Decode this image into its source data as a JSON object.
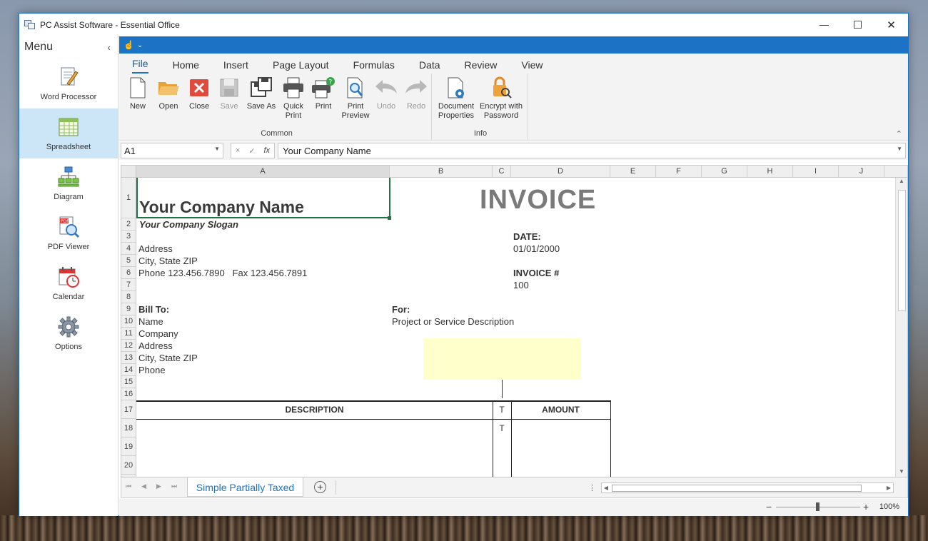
{
  "window": {
    "title": "PC Assist Software - Essential Office",
    "controls": {
      "minimize": "—",
      "maximize": "☐",
      "close": "✕"
    }
  },
  "sidebar": {
    "title": "Menu",
    "collapse_icon": "chevron-left-icon",
    "items": [
      {
        "label": "Word Processor",
        "icon": "word-processor-icon",
        "active": false
      },
      {
        "label": "Spreadsheet",
        "icon": "spreadsheet-icon",
        "active": true
      },
      {
        "label": "Diagram",
        "icon": "diagram-icon",
        "active": false
      },
      {
        "label": "PDF Viewer",
        "icon": "pdf-viewer-icon",
        "active": false
      },
      {
        "label": "Calendar",
        "icon": "calendar-icon",
        "active": false
      },
      {
        "label": "Options",
        "icon": "gear-icon",
        "active": false
      }
    ]
  },
  "qat": {
    "icon": "touch-mode-icon",
    "dropdown": "⌄"
  },
  "ribbon": {
    "tabs": [
      "File",
      "Home",
      "Insert",
      "Page Layout",
      "Formulas",
      "Data",
      "Review",
      "View"
    ],
    "active_tab": "File",
    "groups": {
      "common": {
        "label": "Common",
        "buttons": [
          {
            "label": "New",
            "icon": "new-document-icon",
            "enabled": true
          },
          {
            "label": "Open",
            "icon": "folder-open-icon",
            "enabled": true
          },
          {
            "label": "Close",
            "icon": "close-document-icon",
            "enabled": true
          },
          {
            "label": "Save",
            "icon": "save-icon",
            "enabled": false
          },
          {
            "label": "Save As",
            "icon": "save-as-icon",
            "enabled": true
          },
          {
            "label": "Quick\nPrint",
            "icon": "quick-print-icon",
            "enabled": true
          },
          {
            "label": "Print",
            "icon": "print-icon",
            "enabled": true
          },
          {
            "label": "Print\nPreview",
            "icon": "print-preview-icon",
            "enabled": true
          },
          {
            "label": "Undo",
            "icon": "undo-icon",
            "enabled": false
          },
          {
            "label": "Redo",
            "icon": "redo-icon",
            "enabled": false
          }
        ]
      },
      "info": {
        "label": "Info",
        "buttons": [
          {
            "label": "Document\nProperties",
            "icon": "document-properties-icon",
            "enabled": true
          },
          {
            "label": "Encrypt with\nPassword",
            "icon": "encrypt-lock-icon",
            "enabled": true
          }
        ]
      }
    }
  },
  "formula_bar": {
    "name_box": "A1",
    "cancel_symbol": "×",
    "enter_symbol": "✓",
    "fx_symbol": "fx",
    "value": "Your Company Name"
  },
  "sheet": {
    "columns": [
      "A",
      "B",
      "C",
      "D",
      "E",
      "F",
      "G",
      "H",
      "I",
      "J"
    ],
    "rows": [
      "1",
      "2",
      "3",
      "4",
      "5",
      "6",
      "7",
      "8",
      "9",
      "10",
      "11",
      "12",
      "13",
      "14",
      "15",
      "16",
      "17",
      "18",
      "19",
      "20"
    ],
    "cells": {
      "company_name": "Your Company Name",
      "invoice_title": "INVOICE",
      "slogan": "Your Company Slogan",
      "date_label": "DATE:",
      "address": "Address",
      "date_value": "01/01/2000",
      "city_state_zip": "City, State ZIP",
      "phone_fax": "Phone 123.456.7890   Fax 123.456.7891",
      "invoice_no_label": "INVOICE #",
      "invoice_no_value": "100",
      "bill_to_label": "Bill To:",
      "for_label": "For:",
      "bill_name": "Name",
      "project_desc": "Project or Service Description",
      "bill_company": "Company",
      "bill_address": "Address",
      "bill_city": "City, State ZIP",
      "bill_phone": "Phone",
      "header_description": "DESCRIPTION",
      "header_t": "T",
      "header_amount": "AMOUNT",
      "row18_t": "T"
    },
    "highlight_color": "#ffffcc",
    "active_tab": "Simple Partially Taxed"
  },
  "statusbar": {
    "zoom_minus": "−",
    "zoom_plus": "+",
    "zoom_level": "100%",
    "zoom_fraction": 0.5
  },
  "colors": {
    "accent": "#1c72c4",
    "active_menu_bg": "#cde6f7"
  }
}
